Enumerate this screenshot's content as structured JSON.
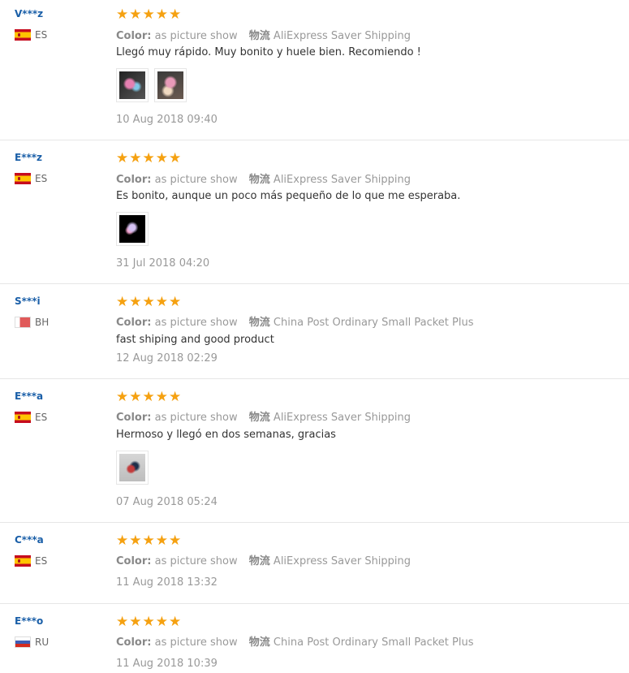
{
  "color_label": "Color:",
  "shipping_label": "物流",
  "stars": "★★★★★",
  "reviews": [
    {
      "user": "V***z",
      "country": "ES",
      "color_value": "as picture show",
      "shipping": "AliExpress Saver Shipping",
      "text": "Llegó muy rápido. Muy bonito y huele bien. Recomiendo !",
      "date": "10 Aug 2018 09:40",
      "photos": 2
    },
    {
      "user": "E***z",
      "country": "ES",
      "color_value": "as picture show",
      "shipping": "AliExpress Saver Shipping",
      "text": "Es bonito, aunque un poco más pequeño de lo que me esperaba.",
      "date": "31 Jul 2018 04:20",
      "photos": 1
    },
    {
      "user": "S***i",
      "country": "BH",
      "color_value": "as picture show",
      "shipping": "China Post Ordinary Small Packet Plus",
      "text": "fast shiping and good product",
      "date": "12 Aug 2018 02:29",
      "photos": 0
    },
    {
      "user": "E***a",
      "country": "ES",
      "color_value": "as picture show",
      "shipping": "AliExpress Saver Shipping",
      "text": "Hermoso y llegó en dos semanas, gracias",
      "date": "07 Aug 2018 05:24",
      "photos": 1
    },
    {
      "user": "C***a",
      "country": "ES",
      "color_value": "as picture show",
      "shipping": "AliExpress Saver Shipping",
      "text": "",
      "date": "11 Aug 2018 13:32",
      "photos": 0
    },
    {
      "user": "E***o",
      "country": "RU",
      "color_value": "as picture show",
      "shipping": "China Post Ordinary Small Packet Plus",
      "text": "",
      "date": "11 Aug 2018 10:39",
      "photos": 0
    }
  ]
}
